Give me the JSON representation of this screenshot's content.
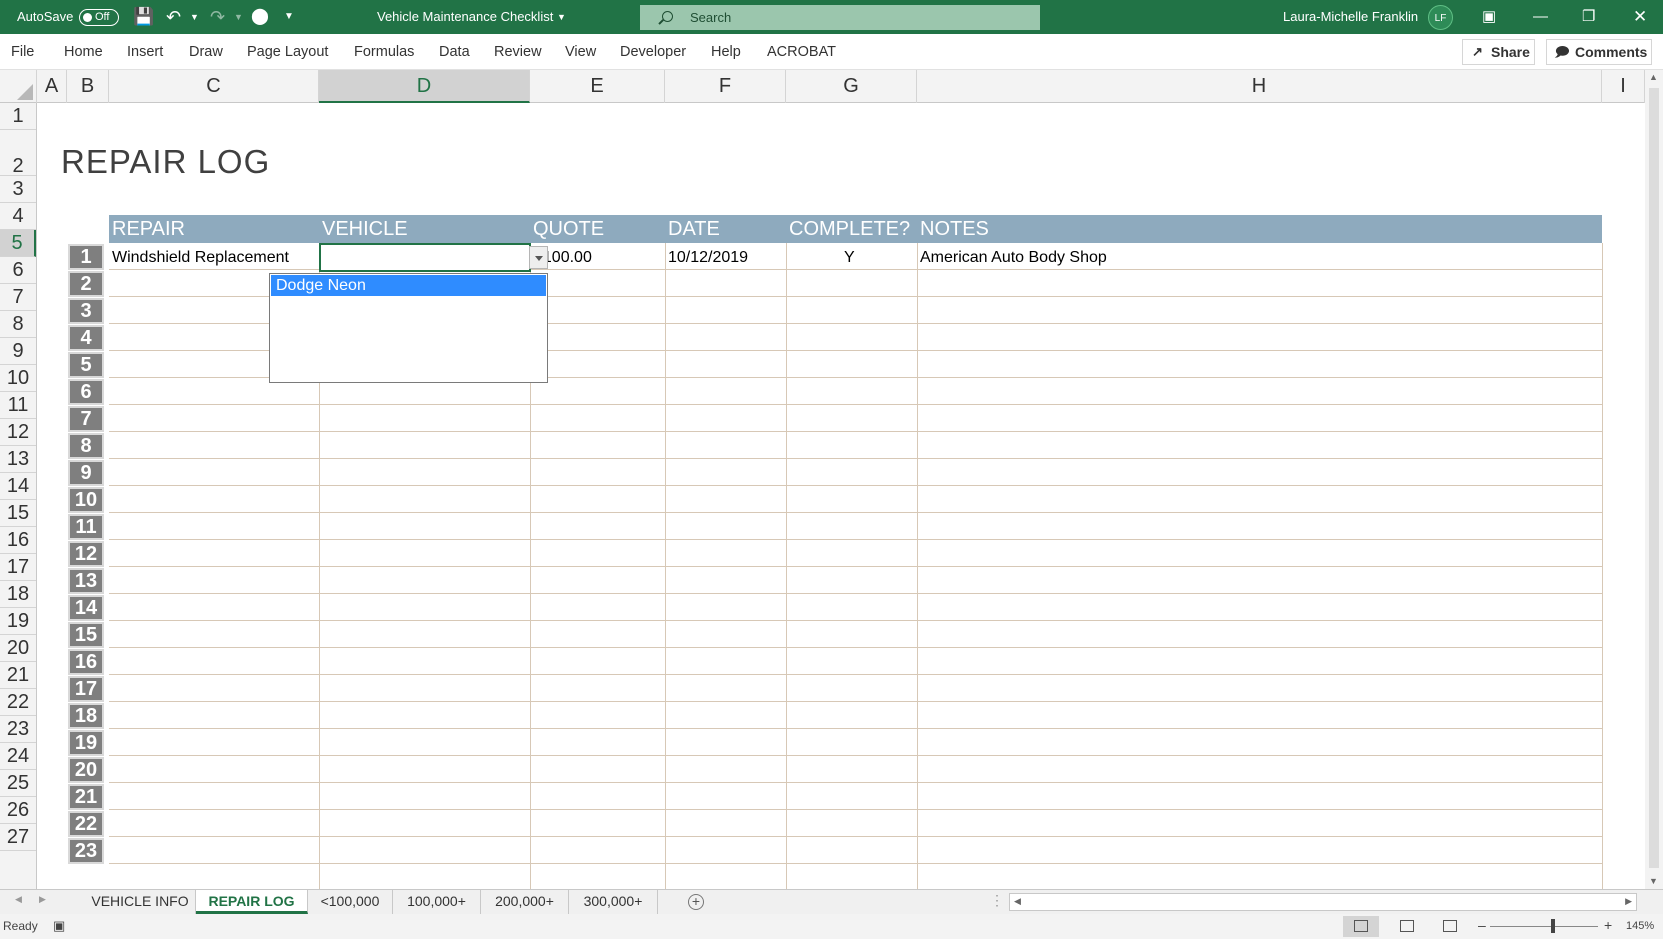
{
  "titlebar": {
    "autosave_label": "AutoSave",
    "autosave_state": "Off",
    "doc_title": "Vehicle Maintenance Checklist",
    "search_placeholder": "Search",
    "user_name": "Laura-Michelle Franklin",
    "user_initials": "LF"
  },
  "menu": {
    "items": [
      "File",
      "Home",
      "Insert",
      "Draw",
      "Page Layout",
      "Formulas",
      "Data",
      "Review",
      "View",
      "Developer",
      "Help",
      "ACROBAT"
    ],
    "share_label": "Share",
    "comments_label": "Comments"
  },
  "columns": [
    "A",
    "B",
    "C",
    "D",
    "E",
    "F",
    "G",
    "H",
    "I"
  ],
  "selected_column": "D",
  "rows": [
    "1",
    "2",
    "3",
    "4",
    "5",
    "6",
    "7",
    "8",
    "9",
    "10",
    "11",
    "12",
    "13",
    "14",
    "15",
    "16",
    "17",
    "18",
    "19",
    "20",
    "21",
    "22",
    "23",
    "24",
    "25",
    "26",
    "27"
  ],
  "selected_row": "5",
  "sheet": {
    "title": "REPAIR LOG",
    "headers": [
      "REPAIR",
      "VEHICLE",
      "QUOTE",
      "DATE",
      "COMPLETE?",
      "NOTES"
    ],
    "entry_numbers": [
      "1",
      "2",
      "3",
      "4",
      "5",
      "6",
      "7",
      "8",
      "9",
      "10",
      "11",
      "12",
      "13",
      "14",
      "15",
      "16",
      "17",
      "18",
      "19",
      "20",
      "21",
      "22",
      "23"
    ],
    "first_row": {
      "repair": "Windshield Replacement",
      "vehicle": "",
      "quote": "$100.00",
      "date": "10/12/2019",
      "complete": "Y",
      "notes": "American Auto Body Shop"
    }
  },
  "dropdown": {
    "options": [
      "Dodge Neon"
    ],
    "highlight_color": "#2f8cff"
  },
  "tabs": {
    "items": [
      "VEHICLE INFO",
      "REPAIR LOG",
      "<100,000",
      "100,000+",
      "200,000+",
      "300,000+"
    ],
    "active": "REPAIR LOG"
  },
  "status": {
    "ready": "Ready",
    "zoom": "145%"
  },
  "colors": {
    "excel_green": "#217346",
    "header_band": "#8eaabe",
    "entry_cell": "#7f7f7f"
  }
}
